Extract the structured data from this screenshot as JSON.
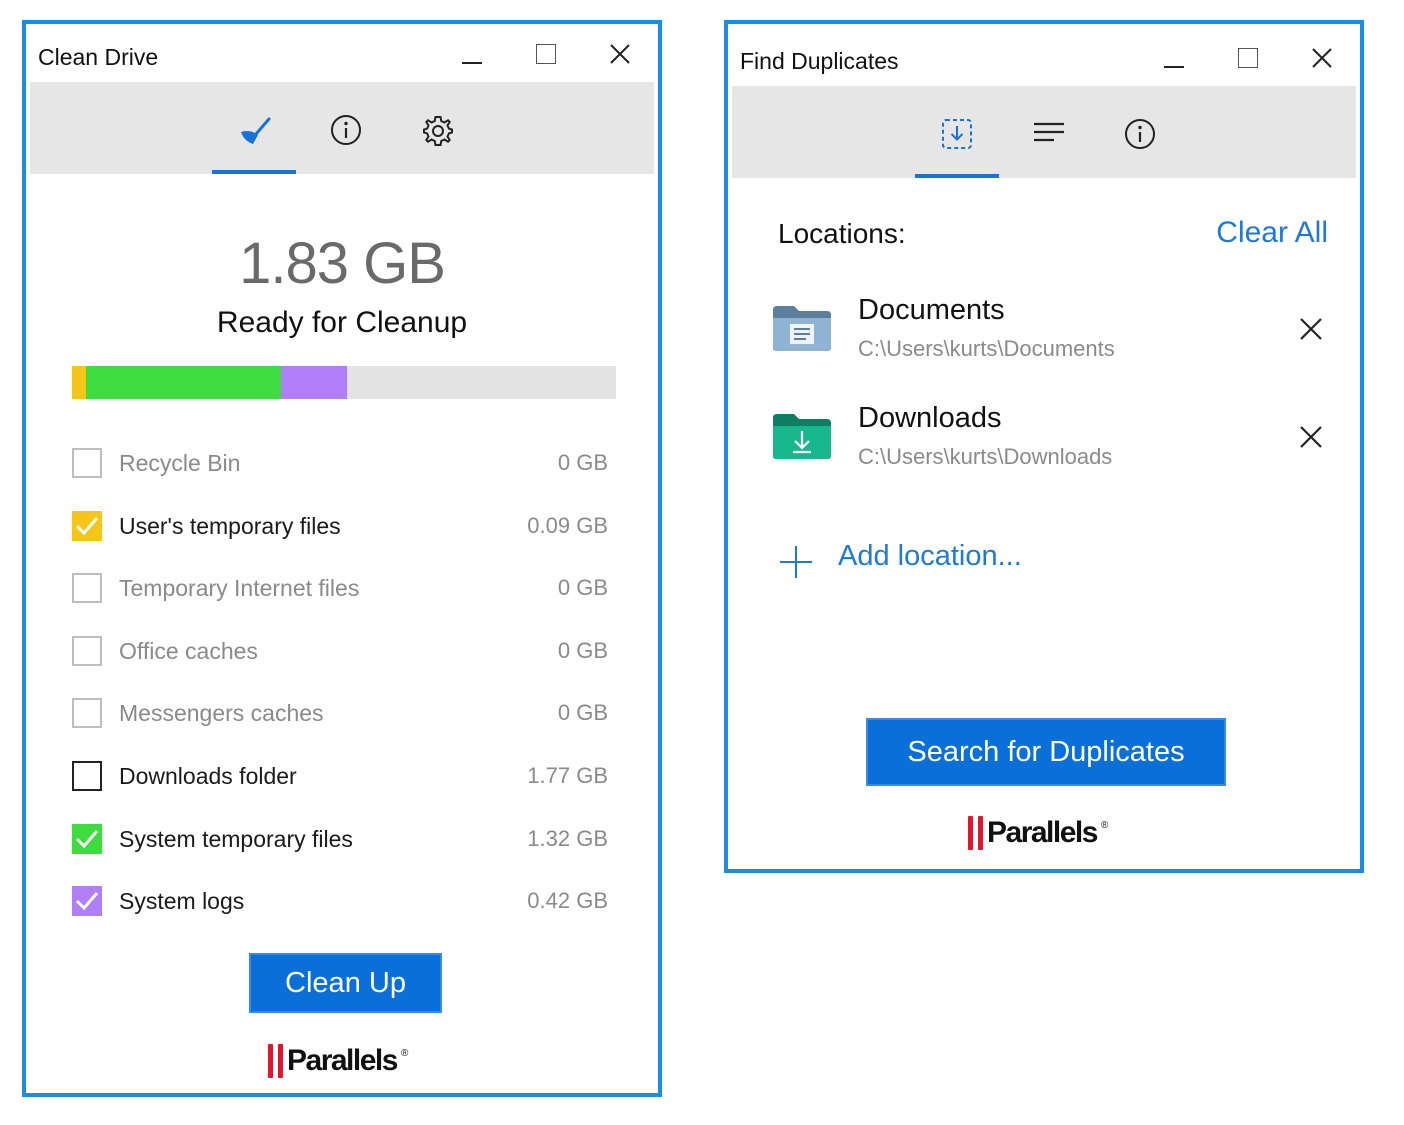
{
  "clean_drive": {
    "title": "Clean Drive",
    "tabs": [
      {
        "icon": "broom-icon",
        "active": true
      },
      {
        "icon": "info-icon",
        "active": false
      },
      {
        "icon": "gear-icon",
        "active": false
      }
    ],
    "total_size": "1.83 GB",
    "subtitle": "Ready for Cleanup",
    "usage_bar": {
      "segments": [
        {
          "name": "User's temporary files",
          "fraction": 0.025,
          "color": "#f5c518"
        },
        {
          "name": "System temporary files",
          "fraction": 0.36,
          "color": "#3fdc3f"
        },
        {
          "name": "System logs",
          "fraction": 0.12,
          "color": "#b07ef7"
        }
      ]
    },
    "items": [
      {
        "label": "Recycle Bin",
        "size": "0 GB",
        "checked": false,
        "enabled": false,
        "color": ""
      },
      {
        "label": "User's temporary files",
        "size": "0.09 GB",
        "checked": true,
        "enabled": true,
        "color": "#f5c518"
      },
      {
        "label": "Temporary Internet files",
        "size": "0 GB",
        "checked": false,
        "enabled": false,
        "color": ""
      },
      {
        "label": "Office caches",
        "size": "0 GB",
        "checked": false,
        "enabled": false,
        "color": ""
      },
      {
        "label": "Messengers caches",
        "size": "0 GB",
        "checked": false,
        "enabled": false,
        "color": ""
      },
      {
        "label": "Downloads folder",
        "size": "1.77 GB",
        "checked": false,
        "enabled": true,
        "color": ""
      },
      {
        "label": "System temporary files",
        "size": "1.32 GB",
        "checked": true,
        "enabled": true,
        "color": "#3fdc3f"
      },
      {
        "label": "System logs",
        "size": "0.42 GB",
        "checked": true,
        "enabled": true,
        "color": "#b07ef7"
      }
    ],
    "action_label": "Clean Up",
    "brand": "Parallels"
  },
  "find_duplicates": {
    "title": "Find Duplicates",
    "tabs": [
      {
        "icon": "import-icon",
        "active": true
      },
      {
        "icon": "list-icon",
        "active": false
      },
      {
        "icon": "info-icon",
        "active": false
      }
    ],
    "locations_label": "Locations:",
    "clear_all_label": "Clear All",
    "locations": [
      {
        "name": "Documents",
        "path": "C:\\Users\\kurts\\Documents",
        "icon": "documents-folder-icon"
      },
      {
        "name": "Downloads",
        "path": "C:\\Users\\kurts\\Downloads",
        "icon": "downloads-folder-icon"
      }
    ],
    "add_location_label": "Add location...",
    "action_label": "Search for Duplicates",
    "brand": "Parallels"
  },
  "colors": {
    "accent": "#0b6fd9",
    "window_border": "#1a8ee6",
    "link": "#1f7ad6"
  }
}
